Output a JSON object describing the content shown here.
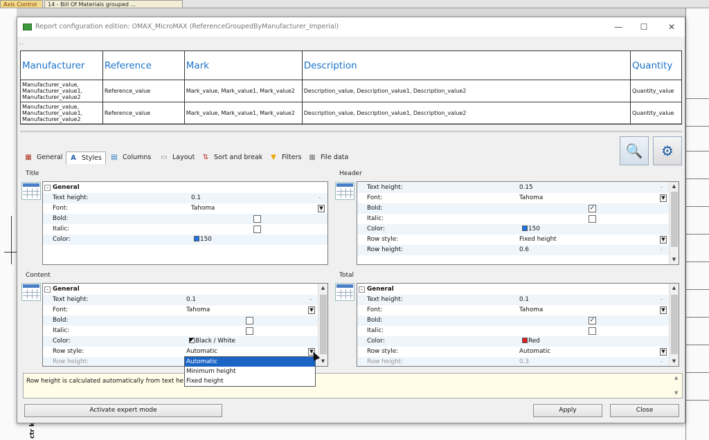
{
  "background": {
    "tabs": [
      "Axis Control",
      "14 - Bill Of Materials grouped ..."
    ],
    "bottom_text": "ctr k"
  },
  "window": {
    "title": "Report configuration edition: OMAX_MicroMAX (ReferenceGroupedByManufacturer_Imperial)",
    "dots": "..",
    "minimize_glyph": "—",
    "maximize_glyph": "☐",
    "close_glyph": "✕"
  },
  "preview": {
    "headers": [
      "Manufacturer",
      "Reference",
      "Mark",
      "Description",
      "Quantity"
    ],
    "rows": [
      [
        "Manufacturer_value, Manufacturer_value1, Manufacturer_value2",
        "Reference_value",
        "Mark_value, Mark_value1, Mark_value2",
        "Description_value, Description_value1, Description_value2",
        "Quantity_value"
      ],
      [
        "Manufacturer_value, Manufacturer_value1, Manufacturer_value2",
        "Reference_value",
        "Mark_value, Mark_value1, Mark_value2",
        "Description_value, Description_value1, Description_value2",
        "Quantity_value"
      ]
    ]
  },
  "tabs": [
    {
      "label": "General",
      "icon": "general-icon"
    },
    {
      "label": "Styles",
      "icon": "styles-icon"
    },
    {
      "label": "Columns",
      "icon": "columns-icon"
    },
    {
      "label": "Layout",
      "icon": "layout-icon"
    },
    {
      "label": "Sort and break",
      "icon": "sort-icon"
    },
    {
      "label": "Filters",
      "icon": "filter-icon"
    },
    {
      "label": "File data",
      "icon": "file-data-icon"
    }
  ],
  "active_tab": "Styles",
  "sections": {
    "title": {
      "label": "Title",
      "group": "General",
      "props": {
        "text_height": {
          "k": "Text height:",
          "v": "0.1"
        },
        "font": {
          "k": "Font:",
          "v": "Tahoma"
        },
        "bold": {
          "k": "Bold:",
          "checked": false
        },
        "italic": {
          "k": "Italic:",
          "checked": false
        },
        "color": {
          "k": "Color:",
          "v": "150",
          "swatch": "#1e73e8"
        }
      }
    },
    "header": {
      "label": "Header",
      "props": {
        "text_height": {
          "k": "Text height:",
          "v": "0.15"
        },
        "font": {
          "k": "Font:",
          "v": "Tahoma"
        },
        "bold": {
          "k": "Bold:",
          "checked": true
        },
        "italic": {
          "k": "Italic:",
          "checked": false
        },
        "color": {
          "k": "Color:",
          "v": "150",
          "swatch": "#1e73e8"
        },
        "row_style": {
          "k": "Row style:",
          "v": "Fixed height"
        },
        "row_height": {
          "k": "Row height:",
          "v": "0.6"
        }
      }
    },
    "content": {
      "label": "Content",
      "group": "General",
      "props": {
        "text_height": {
          "k": "Text height:",
          "v": "0.1"
        },
        "font": {
          "k": "Font:",
          "v": "Tahoma"
        },
        "bold": {
          "k": "Bold:",
          "checked": false
        },
        "italic": {
          "k": "Italic:",
          "checked": false
        },
        "color": {
          "k": "Color:",
          "v": "Black / White"
        },
        "row_style": {
          "k": "Row style:",
          "v": "Automatic"
        },
        "row_height": {
          "k": "Row height:"
        }
      },
      "dropdown_options": [
        "Automatic",
        "Minimum height",
        "Fixed height"
      ],
      "dropdown_selected": "Automatic"
    },
    "total": {
      "label": "Total",
      "group": "General",
      "props": {
        "text_height": {
          "k": "Text height:",
          "v": "0.1"
        },
        "font": {
          "k": "Font:",
          "v": "Tahoma"
        },
        "bold": {
          "k": "Bold:",
          "checked": true
        },
        "italic": {
          "k": "Italic:",
          "checked": false
        },
        "color": {
          "k": "Color:",
          "v": "Red",
          "swatch": "#e02020"
        },
        "row_style": {
          "k": "Row style:",
          "v": "Automatic"
        },
        "row_height": {
          "k": "Row height:",
          "v": "0.3"
        }
      }
    }
  },
  "help_text": "Row height is calculated automatically from text height",
  "buttons": {
    "expert": "Activate expert mode",
    "apply": "Apply",
    "close": "Close"
  }
}
